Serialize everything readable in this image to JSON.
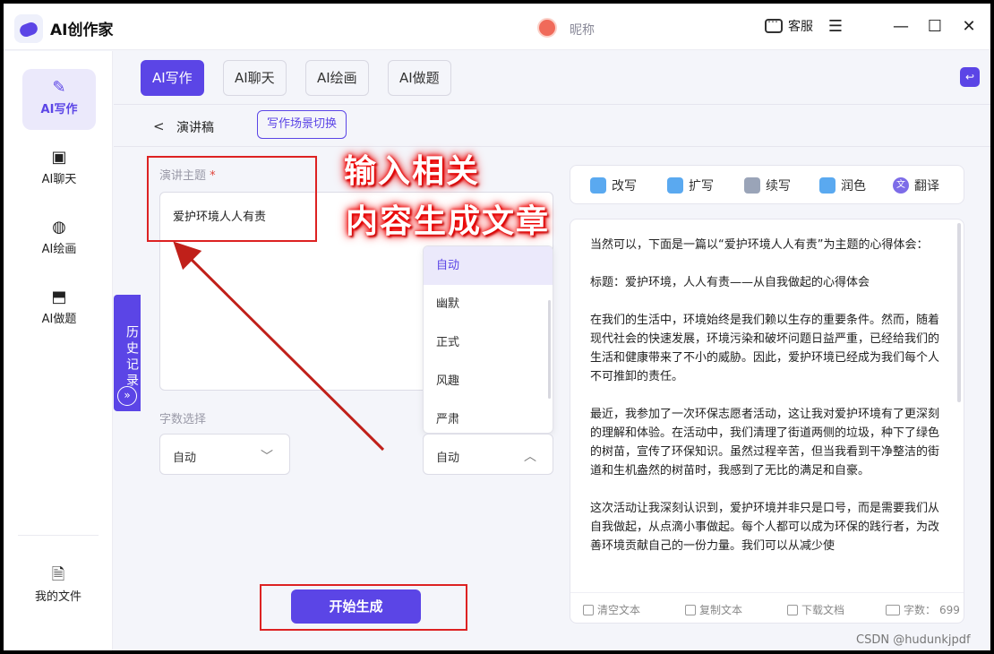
{
  "app": {
    "title": "AI创作家",
    "nickname": "昵称",
    "service_label": "客服"
  },
  "sidebar": {
    "items": [
      {
        "label": "AI写作",
        "icon": "pen-icon"
      },
      {
        "label": "AI聊天",
        "icon": "chat-icon"
      },
      {
        "label": "AI绘画",
        "icon": "palette-icon"
      },
      {
        "label": "AI做题",
        "icon": "bookmark-icon"
      }
    ],
    "files_label": "我的文件"
  },
  "history_label": "历史记录",
  "tabs": [
    "AI写作",
    "AI聊天",
    "AI绘画",
    "AI做题"
  ],
  "crumb": {
    "back": "<",
    "title": "演讲稿",
    "switch_label": "写作场景切换"
  },
  "form": {
    "topic_label": "演讲主题",
    "required_mark": "*",
    "topic_value": "爱护环境人人有责",
    "word_count_label": "字数选择",
    "word_count_value": "自动",
    "style_value": "自动",
    "style_options": [
      "自动",
      "幽默",
      "正式",
      "风趣",
      "严肃"
    ]
  },
  "generate_label": "开始生成",
  "annotation": {
    "line1": "输入相关",
    "line2": "内容生成文章"
  },
  "tools": [
    "改写",
    "扩写",
    "续写",
    "润色",
    "翻译"
  ],
  "output": {
    "paragraphs": [
      "当然可以，下面是一篇以“爱护环境人人有责”为主题的心得体会：",
      "标题：爱护环境，人人有责——从自我做起的心得体会",
      "在我们的生活中，环境始终是我们赖以生存的重要条件。然而，随着现代社会的快速发展，环境污染和破坏问题日益严重，已经给我们的生活和健康带来了不小的威胁。因此，爱护环境已经成为我们每个人不可推卸的责任。",
      "最近，我参加了一次环保志愿者活动，这让我对爱护环境有了更深刻的理解和体验。在活动中，我们清理了街道两侧的垃圾，种下了绿色的树苗，宣传了环保知识。虽然过程辛苦，但当我看到干净整洁的街道和生机盎然的树苗时，我感到了无比的满足和自豪。",
      "这次活动让我深刻认识到，爱护环境并非只是口号，而是需要我们从自我做起，从点滴小事做起。每个人都可以成为环保的践行者，为改善环境贡献自己的一份力量。我们可以从减少使"
    ],
    "footer": {
      "clear": "清空文本",
      "copy": "复制文本",
      "download": "下载文档",
      "count_label": "字数：",
      "count": "699"
    }
  },
  "watermark": "CSDN @hudunkjpdf"
}
